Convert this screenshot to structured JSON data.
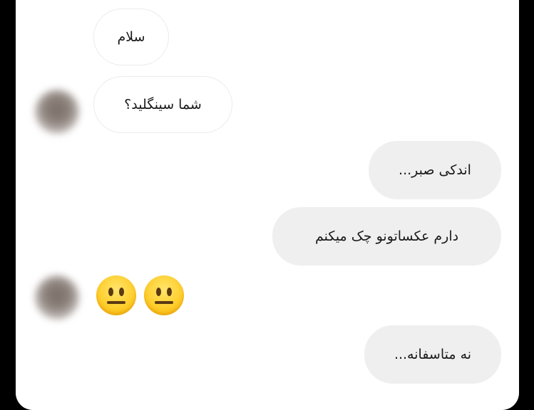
{
  "messages": {
    "incoming": [
      {
        "text": "سلام"
      },
      {
        "text": "شما سینگلید؟"
      }
    ],
    "outgoing": [
      {
        "text": "اندکی صبر..."
      },
      {
        "text": "دارم عکساتونو چک میکنم"
      },
      {
        "text": "نه متاسفانه..."
      }
    ],
    "reaction_emojis": [
      "neutral-face-emoji",
      "neutral-face-emoji"
    ]
  },
  "colors": {
    "background": "#000000",
    "panel": "#ffffff",
    "outgoing_bubble": "#efefef",
    "incoming_border": "#ebebeb",
    "text": "#1a1a1a"
  }
}
